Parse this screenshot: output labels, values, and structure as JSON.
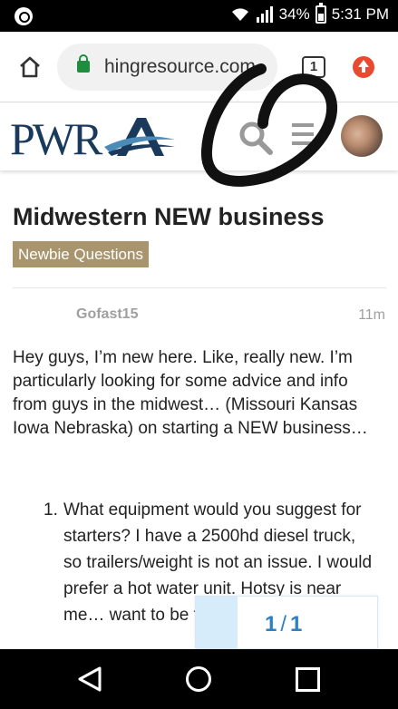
{
  "status_bar": {
    "battery": "34%",
    "time": "5:31 PM",
    "icons": [
      "notification-icon",
      "wifi-icon",
      "signal-icon",
      "battery-icon"
    ]
  },
  "browser": {
    "url": "hingresource.com",
    "tab_count": "1"
  },
  "site": {
    "logo_text": "PWRA",
    "colors": {
      "brand_navy": "#1a3a5c",
      "accent_gold": "#a8956e",
      "link_blue": "#2f7fc1"
    }
  },
  "topic": {
    "title": "Midwestern NEW business",
    "category": "Newbie Questions"
  },
  "post": {
    "username": "Gofast15",
    "age": "11m",
    "paragraph": "Hey guys, I’m new here. Like, really new. I’m particularly looking for some advice and info from guys in the midwest… (Missouri Kansas Iowa Nebraska) on starting a NEW business…",
    "list": [
      {
        "number": "1.",
        "text": "What equipment would you suggest for starters? I have a 2500hd diesel truck, so trailers/weight is not an issue. I would prefer a hot water unit. Hotsy is near me… want to be too li…"
      }
    ]
  },
  "pager": {
    "current": "1",
    "separator": "/",
    "total": "1"
  }
}
